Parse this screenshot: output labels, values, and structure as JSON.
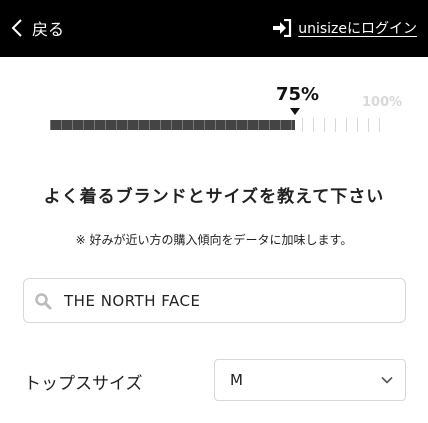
{
  "header": {
    "back_label": "戻る",
    "login_label": "unisizeにログイン"
  },
  "progress": {
    "value": 0.75,
    "current_label": "75%",
    "max_label": "100%"
  },
  "main": {
    "headline": "よく着るブランドとサイズを教えて下さい",
    "note": "※ 好みが近い方の購入傾向をデータに加味します。"
  },
  "search": {
    "value": "THE NORTH FACE",
    "placeholder": ""
  },
  "tops_size": {
    "label": "トップスサイズ",
    "selected": "M"
  },
  "icons": {
    "back": "chevron-left-icon",
    "login": "login-arrow-icon",
    "search": "search-icon",
    "select": "chevron-down-icon"
  },
  "colors": {
    "header_bg": "#000000",
    "bar_fill": "#444444",
    "bar_empty": "#d9d9d9"
  }
}
